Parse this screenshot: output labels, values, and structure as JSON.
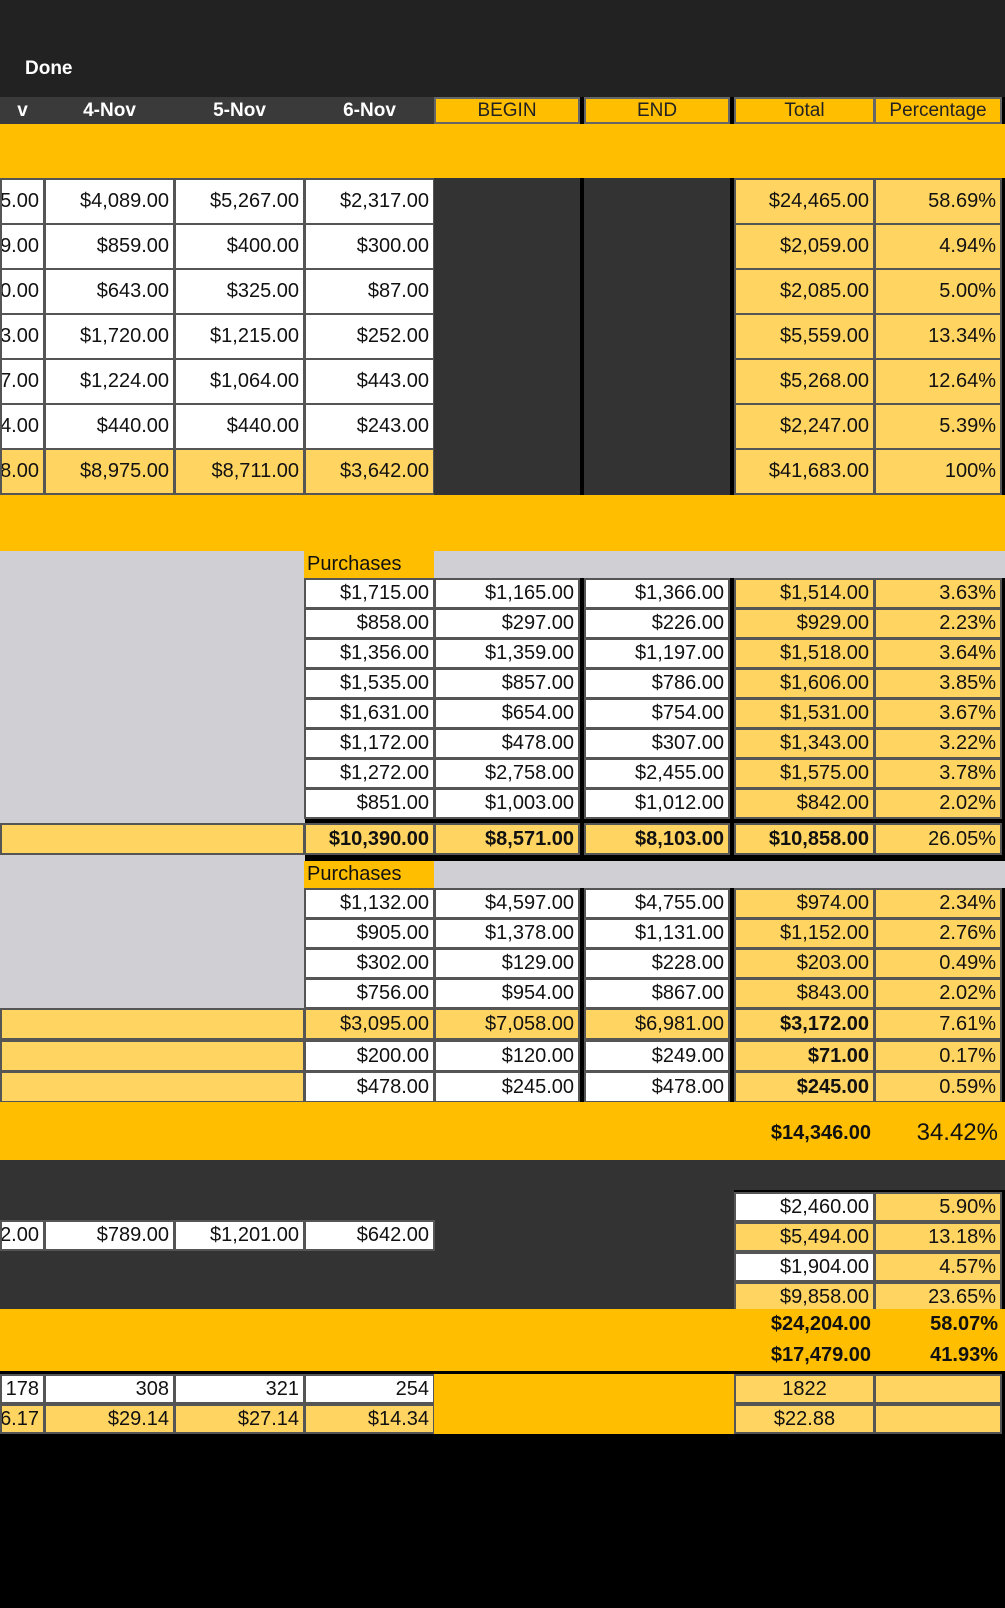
{
  "toolbar": {
    "done_label": "Done"
  },
  "header": {
    "partial": "v",
    "cols": [
      "4-Nov",
      "5-Nov",
      "6-Nov",
      "BEGIN",
      "END",
      "Total",
      "Percentage"
    ]
  },
  "sales": {
    "rows": [
      {
        "partial": "5.00",
        "d4": "$4,089.00",
        "d5": "$5,267.00",
        "d6": "$2,317.00",
        "total": "$24,465.00",
        "pct": "58.69%"
      },
      {
        "partial": "9.00",
        "d4": "$859.00",
        "d5": "$400.00",
        "d6": "$300.00",
        "total": "$2,059.00",
        "pct": "4.94%"
      },
      {
        "partial": "0.00",
        "d4": "$643.00",
        "d5": "$325.00",
        "d6": "$87.00",
        "total": "$2,085.00",
        "pct": "5.00%"
      },
      {
        "partial": "3.00",
        "d4": "$1,720.00",
        "d5": "$1,215.00",
        "d6": "$252.00",
        "total": "$5,559.00",
        "pct": "13.34%"
      },
      {
        "partial": "7.00",
        "d4": "$1,224.00",
        "d5": "$1,064.00",
        "d6": "$443.00",
        "total": "$5,268.00",
        "pct": "12.64%"
      },
      {
        "partial": "4.00",
        "d4": "$440.00",
        "d5": "$440.00",
        "d6": "$243.00",
        "total": "$2,247.00",
        "pct": "5.39%"
      }
    ],
    "total_row": {
      "partial": "8.00",
      "d4": "$8,975.00",
      "d5": "$8,711.00",
      "d6": "$3,642.00",
      "total": "$41,683.00",
      "pct": "100%"
    }
  },
  "purchases1": {
    "label": "Purchases",
    "rows": [
      {
        "p": "$1,715.00",
        "b": "$1,165.00",
        "e": "$1,366.00",
        "t": "$1,514.00",
        "pct": "3.63%"
      },
      {
        "p": "$858.00",
        "b": "$297.00",
        "e": "$226.00",
        "t": "$929.00",
        "pct": "2.23%"
      },
      {
        "p": "$1,356.00",
        "b": "$1,359.00",
        "e": "$1,197.00",
        "t": "$1,518.00",
        "pct": "3.64%"
      },
      {
        "p": "$1,535.00",
        "b": "$857.00",
        "e": "$786.00",
        "t": "$1,606.00",
        "pct": "3.85%"
      },
      {
        "p": "$1,631.00",
        "b": "$654.00",
        "e": "$754.00",
        "t": "$1,531.00",
        "pct": "3.67%"
      },
      {
        "p": "$1,172.00",
        "b": "$478.00",
        "e": "$307.00",
        "t": "$1,343.00",
        "pct": "3.22%"
      },
      {
        "p": "$1,272.00",
        "b": "$2,758.00",
        "e": "$2,455.00",
        "t": "$1,575.00",
        "pct": "3.78%"
      },
      {
        "p": "$851.00",
        "b": "$1,003.00",
        "e": "$1,012.00",
        "t": "$842.00",
        "pct": "2.02%"
      }
    ],
    "total": {
      "p": "$10,390.00",
      "b": "$8,571.00",
      "e": "$8,103.00",
      "t": "$10,858.00",
      "pct": "26.05%"
    }
  },
  "purchases2": {
    "label": "Purchases",
    "rows": [
      {
        "p": "$1,132.00",
        "b": "$4,597.00",
        "e": "$4,755.00",
        "t": "$974.00",
        "pct": "2.34%"
      },
      {
        "p": "$905.00",
        "b": "$1,378.00",
        "e": "$1,131.00",
        "t": "$1,152.00",
        "pct": "2.76%"
      },
      {
        "p": "$302.00",
        "b": "$129.00",
        "e": "$228.00",
        "t": "$203.00",
        "pct": "0.49%"
      },
      {
        "p": "$756.00",
        "b": "$954.00",
        "e": "$867.00",
        "t": "$843.00",
        "pct": "2.02%"
      }
    ],
    "total": {
      "p": "$3,095.00",
      "b": "$7,058.00",
      "e": "$6,981.00",
      "t": "$3,172.00",
      "pct": "7.61%"
    },
    "extra": [
      {
        "p": "$200.00",
        "b": "$120.00",
        "e": "$249.00",
        "t": "$71.00",
        "pct": "0.17%"
      },
      {
        "p": "$478.00",
        "b": "$245.00",
        "e": "$478.00",
        "t": "$245.00",
        "pct": "0.59%"
      }
    ]
  },
  "cogs_total": {
    "t": "$14,346.00",
    "pct": "34.42%"
  },
  "expenses": {
    "rows": [
      {
        "t": "$2,460.00",
        "pct": "5.90%"
      },
      {
        "t": "$5,494.00",
        "pct": "13.18%"
      },
      {
        "t": "$1,904.00",
        "pct": "4.57%"
      },
      {
        "t": "$9,858.00",
        "pct": "23.65%"
      }
    ],
    "daily": {
      "partial": "2.00",
      "d4": "$789.00",
      "d5": "$1,201.00",
      "d6": "$642.00"
    }
  },
  "summary": [
    {
      "t": "$24,204.00",
      "pct": "58.07%"
    },
    {
      "t": "$17,479.00",
      "pct": "41.93%"
    }
  ],
  "counts": {
    "partial": "178",
    "d4": "308",
    "d5": "321",
    "d6": "254",
    "total": "1822"
  },
  "avg": {
    "partial": "6.17",
    "d4": "$29.14",
    "d5": "$27.14",
    "d6": "$14.34",
    "total": "$22.88"
  }
}
